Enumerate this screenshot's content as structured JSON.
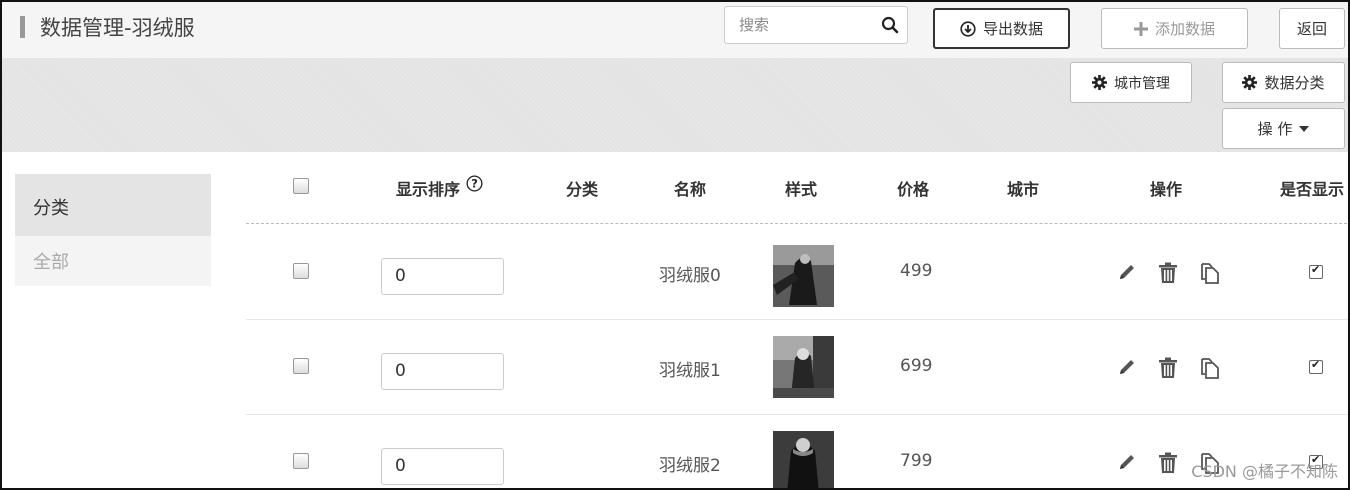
{
  "header": {
    "title": "数据管理-羽绒服",
    "search_placeholder": "搜索",
    "export_label": "导出数据",
    "add_label": "添加数据",
    "back_label": "返回"
  },
  "toolbar": {
    "city_mgmt_label": "城市管理",
    "data_category_label": "数据分类",
    "operation_label": "操 作"
  },
  "sidebar": {
    "heading": "分类",
    "items": [
      {
        "label": "全部"
      }
    ]
  },
  "table": {
    "columns": [
      "显示排序",
      "分类",
      "名称",
      "样式",
      "价格",
      "城市",
      "操作",
      "是否显示"
    ],
    "rows": [
      {
        "sort": "0",
        "category": "",
        "name": "羽绒服0",
        "price": "499",
        "city": "",
        "visible": true
      },
      {
        "sort": "0",
        "category": "",
        "name": "羽绒服1",
        "price": "699",
        "city": "",
        "visible": true
      },
      {
        "sort": "0",
        "category": "",
        "name": "羽绒服2",
        "price": "799",
        "city": "",
        "visible": true
      }
    ]
  },
  "watermark": "CSDN @橘子不知陈",
  "icons": [
    "search-icon",
    "download-icon",
    "plus-icon",
    "gear-icon",
    "caret-down-icon",
    "help-icon",
    "edit-icon",
    "trash-icon",
    "copy-icon"
  ]
}
